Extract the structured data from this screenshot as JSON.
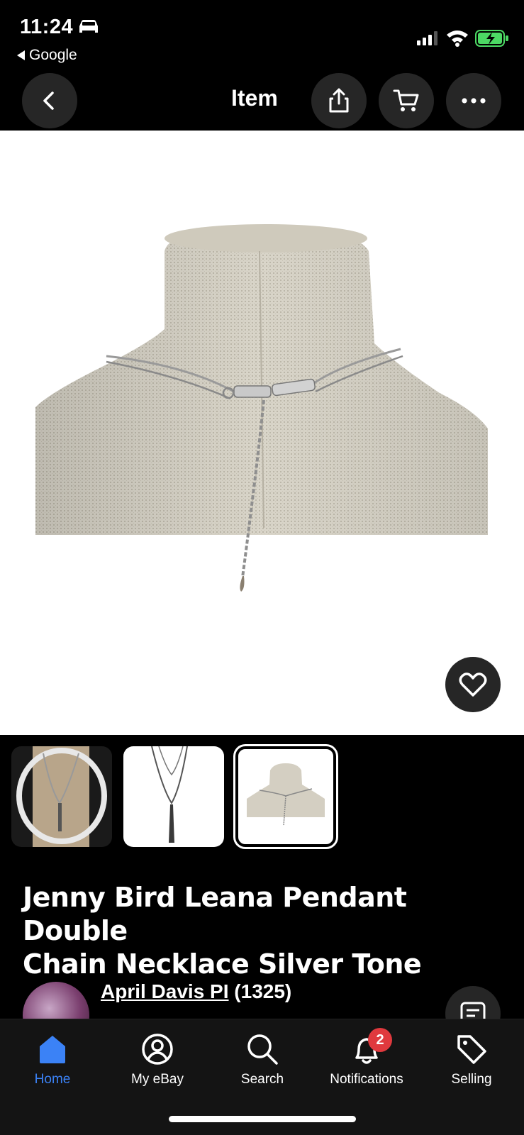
{
  "status_bar": {
    "time": "11:24",
    "back_app": "Google"
  },
  "nav": {
    "title": "Item"
  },
  "item": {
    "title_line1": "Jenny Bird Leana Pendant Double",
    "title_line2": "Chain Necklace Silver Tone",
    "thumbnail_count": 3,
    "selected_thumbnail": 3
  },
  "seller": {
    "name": "April Davis PI",
    "feedback": "(1325)"
  },
  "tabs": [
    {
      "label": "Home",
      "icon": "home-icon",
      "active": true
    },
    {
      "label": "My eBay",
      "icon": "user-icon",
      "active": false
    },
    {
      "label": "Search",
      "icon": "search-icon",
      "active": false
    },
    {
      "label": "Notifications",
      "icon": "bell-icon",
      "active": false,
      "badge": "2"
    },
    {
      "label": "Selling",
      "icon": "tag-icon",
      "active": false
    }
  ],
  "colors": {
    "accent": "#3b82f6",
    "badge": "#e0393e",
    "battery": "#4cd964"
  }
}
